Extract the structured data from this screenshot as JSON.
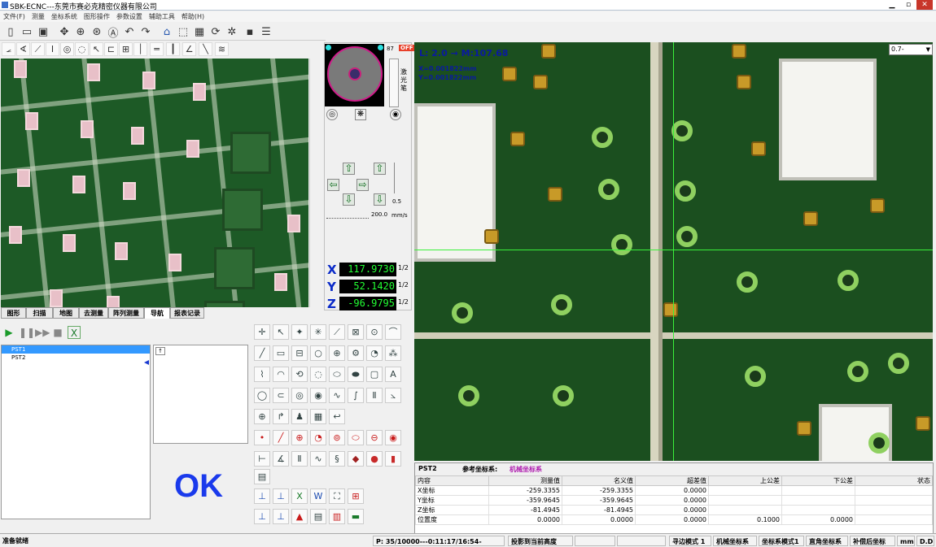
{
  "window": {
    "title": "SBK-ECNC---东莞市赛必克精密仪器有限公司",
    "min": "▁",
    "max": "▫",
    "close": "✕"
  },
  "menu": [
    "文件(F)",
    "测量",
    "坐标系统",
    "图形操作",
    "参数设置",
    "辅助工具",
    "帮助(H)"
  ],
  "toolbar_icons": [
    "new-file-icon",
    "open-folder-icon",
    "save-icon",
    "move-icon",
    "zoom-icon",
    "target-icon",
    "text-a-icon",
    "undo-icon",
    "redo-icon",
    "home-icon",
    "select-icon",
    "image-icon",
    "refresh-icon",
    "settings-gear-icon",
    "grid-icon",
    "list-icon"
  ],
  "left_tabs": [
    "图形",
    "扫描",
    "地图",
    "去测量",
    "阵列测量",
    "导航",
    "报表记录"
  ],
  "minimap": {
    "counter": "87",
    "off_label": "OFF",
    "laser_label": "激光笔",
    "speed": "200.0",
    "speed_unit": "mm/s",
    "step": "0.5"
  },
  "axes": [
    {
      "label": "X",
      "value": "117.9730",
      "half": "1/2"
    },
    {
      "label": "Y",
      "value": "52.1420",
      "half": "1/2"
    },
    {
      "label": "Z",
      "value": "-96.9795",
      "half": "1/2"
    }
  ],
  "list": {
    "items": [
      "PST1",
      "PST2"
    ]
  },
  "ok_text": "OK",
  "camera": {
    "length": "L: 2.0",
    "magnification": "M:107.68",
    "x_readout": "X=0.001822mm",
    "y_readout": "Y=0.001822mm",
    "zoom": "0.7-"
  },
  "results": {
    "name": "PST2",
    "ref_label": "参考坐标系:",
    "ref_value": "机械坐标系",
    "headers": [
      "内容",
      "测量值",
      "名义值",
      "超差值",
      "上公差",
      "下公差",
      "状态"
    ],
    "rows": [
      [
        "X坐标",
        "-259.3355",
        "-259.3355",
        "0.0000",
        "",
        "",
        ""
      ],
      [
        "Y坐标",
        "-359.9645",
        "-359.9645",
        "0.0000",
        "",
        "",
        ""
      ],
      [
        "Z坐标",
        "-81.4945",
        "-81.4945",
        "0.0000",
        "",
        "",
        ""
      ],
      [
        "位置度",
        "0.0000",
        "0.0000",
        "0.0000",
        "0.1000",
        "0.0000",
        ""
      ]
    ]
  },
  "status": {
    "ready": "准备就绪",
    "position": "P: 35/10000---0:11:17/16:54-",
    "project": "投影到当前高度",
    "find_mode": "寻边模式 1",
    "machine_coord": "机械坐标系",
    "coord_mode": "坐标系模式1",
    "rect_coord": "直角坐标系",
    "comp": "补偿后坐标",
    "unit": "mm",
    "dd": "D.D"
  }
}
